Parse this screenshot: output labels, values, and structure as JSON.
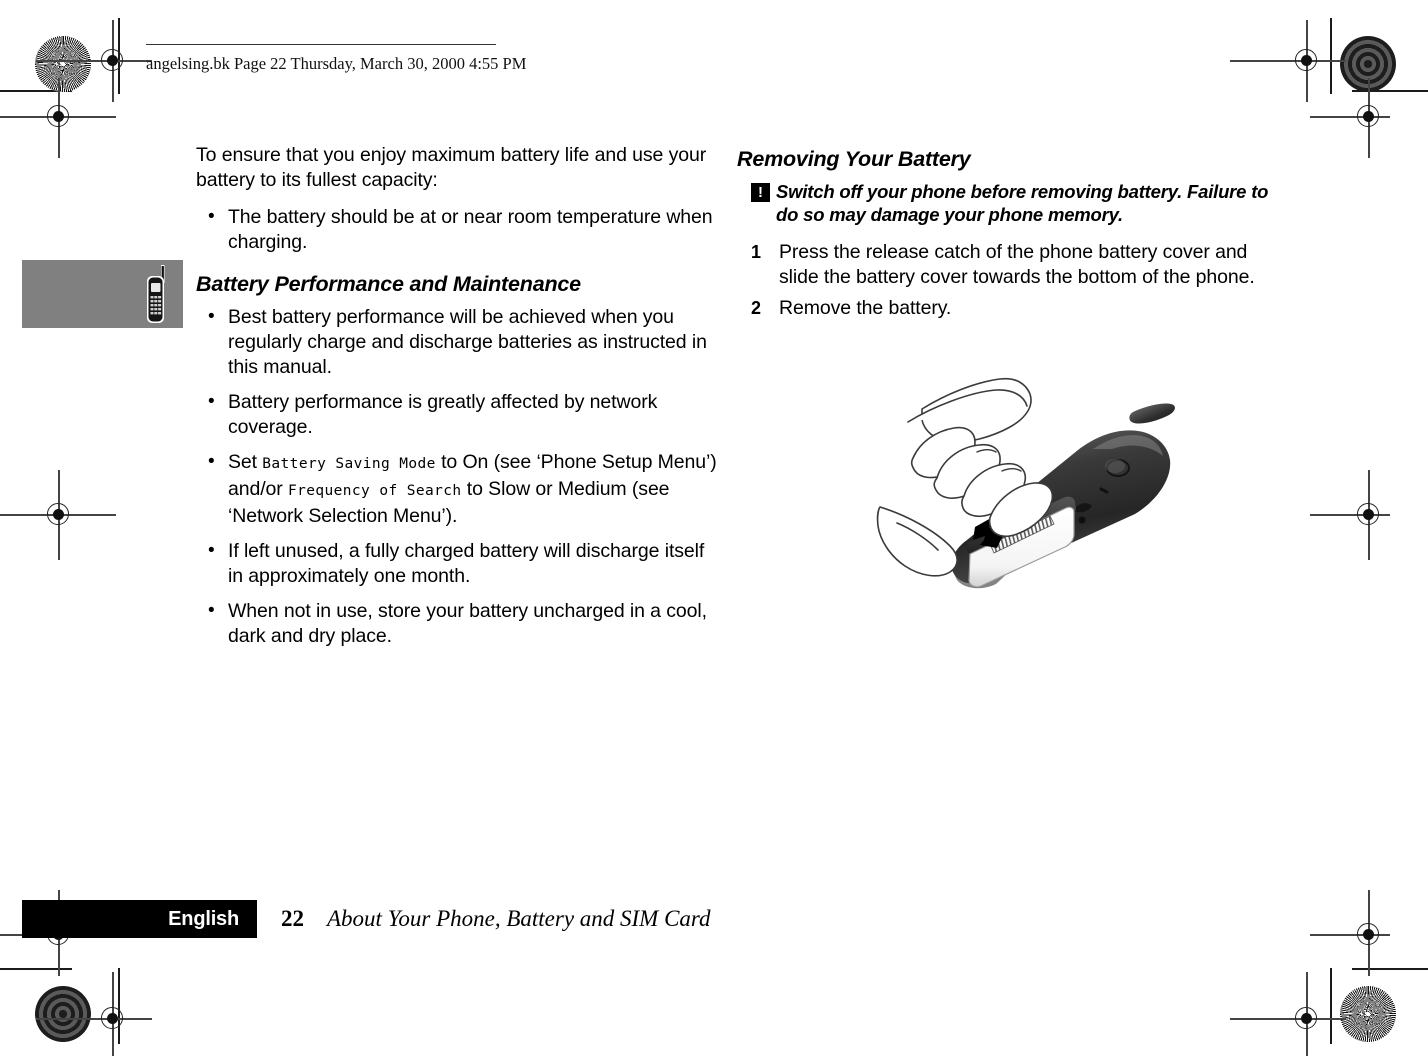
{
  "page": {
    "slug": "angelsing.bk  Page 22  Thursday, March 30, 2000  4:55 PM",
    "number": "22",
    "running_title": "About Your Phone, Battery and SIM Card",
    "language_tab": "English",
    "grey_box_icon": "mobile-phone-icon"
  },
  "left_column": {
    "intro": "To ensure that you enjoy maximum battery life and use your battery to its fullest capacity:",
    "intro_bullets": [
      "The battery should be at or near room temperature when charging."
    ],
    "section_heading": "Battery Performance and Maintenance",
    "bullets": [
      {
        "parts": [
          {
            "type": "text",
            "value": "Best battery performance will be achieved when you regularly charge and discharge batteries as instructed in this manual."
          }
        ]
      },
      {
        "parts": [
          {
            "type": "text",
            "value": "Battery performance is greatly affected by network coverage."
          }
        ]
      },
      {
        "parts": [
          {
            "type": "text",
            "value": "Set "
          },
          {
            "type": "code",
            "value": "Battery Saving Mode"
          },
          {
            "type": "text",
            "value": " to On (see ‘Phone Setup Menu’) and/or "
          },
          {
            "type": "code",
            "value": "Frequency of Search"
          },
          {
            "type": "text",
            "value": " to Slow or Medium (see ‘Network Selection Menu’)."
          }
        ]
      },
      {
        "parts": [
          {
            "type": "text",
            "value": "If left unused, a fully charged battery will discharge itself in approximately one month."
          }
        ]
      },
      {
        "parts": [
          {
            "type": "text",
            "value": "When not in use, store your battery uncharged in a cool, dark and dry place."
          }
        ]
      }
    ]
  },
  "right_column": {
    "section_heading": "Removing Your Battery",
    "warning_icon": "!",
    "warning": "Switch off your phone before removing battery. Failure to do so may damage your phone memory.",
    "steps": [
      {
        "num": "1",
        "text": "Press the release catch of the phone battery cover and slide the battery cover towards the bottom of the phone."
      },
      {
        "num": "2",
        "text": "Remove the battery."
      }
    ],
    "illustration_alt": "hand-removing-battery-cover-illustration"
  },
  "colors": {
    "grey_box": "#808080",
    "footer_bar": "#000000",
    "text": "#000000"
  }
}
